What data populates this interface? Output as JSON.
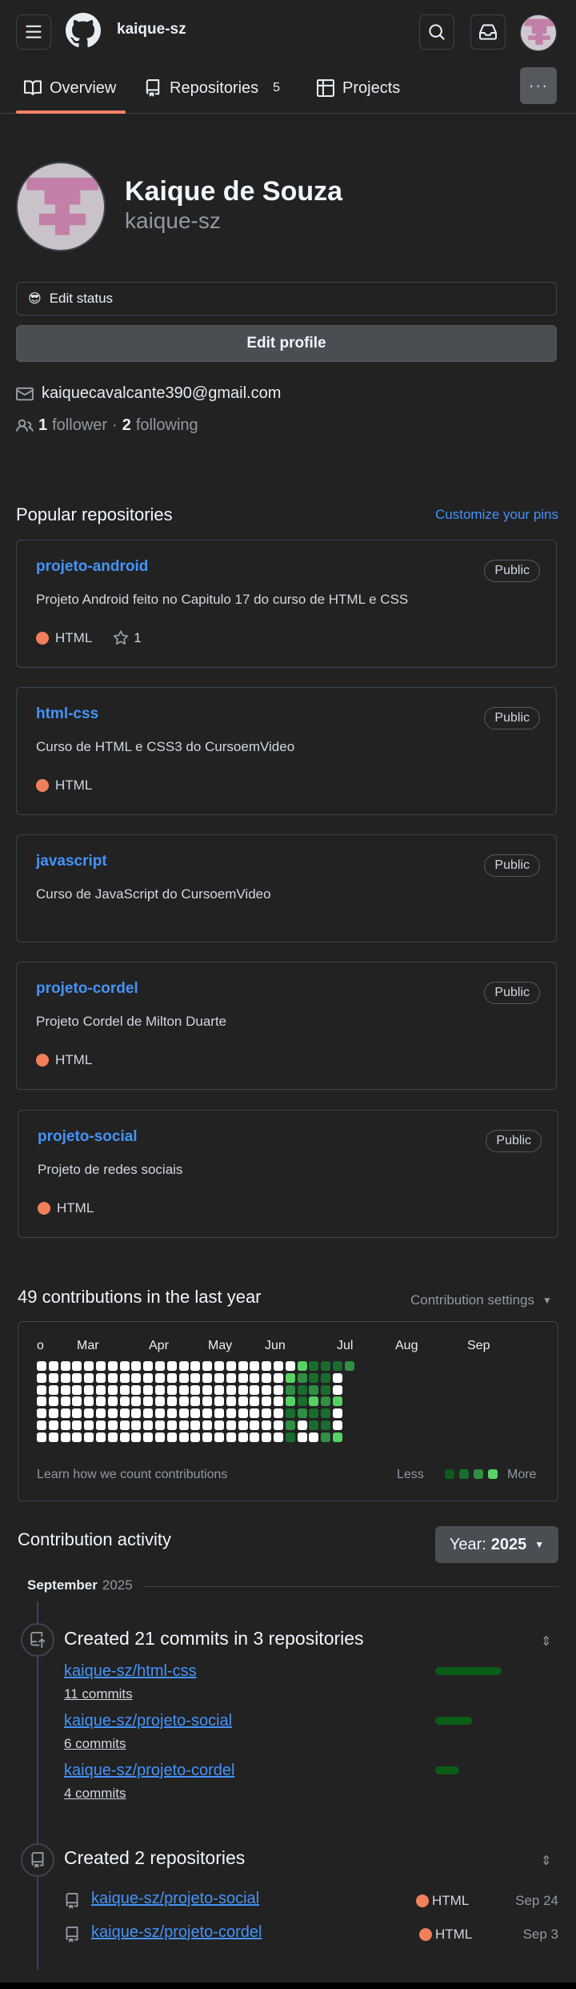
{
  "header": {
    "username": "kaique-sz",
    "icons": {
      "menu": "hamburger-icon",
      "logo": "github-logo-icon",
      "search": "search-icon",
      "inbox": "inbox-icon"
    }
  },
  "tabs": [
    {
      "label": "Overview",
      "icon": "book-icon"
    },
    {
      "label": "Repositories",
      "icon": "repo-icon",
      "count": "5"
    },
    {
      "label": "Projects",
      "icon": "table-icon"
    }
  ],
  "more_label": "···",
  "profile": {
    "name": "Kaique de Souza",
    "login": "kaique-sz",
    "status_emoji": "😎",
    "status_label": "Edit status",
    "edit_profile_label": "Edit profile",
    "email": "kaiquecavalcante390@gmail.com",
    "followers_count": "1",
    "followers_label": "follower",
    "separator": "·",
    "following_count": "2",
    "following_label": "following"
  },
  "popular": {
    "title": "Popular repositories",
    "customize_label": "Customize your pins",
    "repos": [
      {
        "name": "projeto-android",
        "visibility": "Public",
        "description": "Projeto Android feito no Capitulo 17 do curso de HTML e CSS",
        "language": "HTML",
        "stars": "1"
      },
      {
        "name": "html-css",
        "visibility": "Public",
        "description": "Curso de HTML e CSS3 do CursoemVideo",
        "language": "HTML"
      },
      {
        "name": "javascript",
        "visibility": "Public",
        "description": "Curso de JavaScript do CursoemVideo"
      },
      {
        "name": "projeto-cordel",
        "visibility": "Public",
        "description": "Projeto Cordel de Milton Duarte",
        "language": "HTML"
      },
      {
        "name": "projeto-social",
        "visibility": "Public",
        "description": "Projeto de redes sociais",
        "language": "HTML"
      }
    ],
    "language_color": "#f1805a"
  },
  "contributions": {
    "title": "49 contributions in the last year",
    "settings_label": "Contribution settings",
    "months": [
      "o",
      "Mar",
      "Apr",
      "May",
      "Jun",
      "Jul",
      "Aug",
      "Sep"
    ],
    "learn_label": "Learn how we count contributions",
    "less_label": "Less",
    "more_label": "More",
    "colors": {
      "empty": "#ffffff",
      "l1": "#0b5c17",
      "l2": "#196c2e",
      "l3": "#2f8f43",
      "l4": "#56d364"
    }
  },
  "activity": {
    "title": "Contribution activity",
    "year_label": "Year:",
    "year_value": "2025",
    "month": "September",
    "month_year": "2025",
    "commits": {
      "title": "Created 21 commits in 3 repositories",
      "items": [
        {
          "repo": "kaique-sz/html-css",
          "commits": "11 commits",
          "share": 0.52
        },
        {
          "repo": "kaique-sz/projeto-social",
          "commits": "6 commits",
          "share": 0.29
        },
        {
          "repo": "kaique-sz/projeto-cordel",
          "commits": "4 commits",
          "share": 0.19
        }
      ]
    },
    "created": {
      "title": "Created 2 repositories",
      "items": [
        {
          "repo": "kaique-sz/projeto-social",
          "language": "HTML",
          "date": "Sep 24"
        },
        {
          "repo": "kaique-sz/projeto-cordel",
          "language": "HTML",
          "date": "Sep 3"
        }
      ]
    }
  }
}
